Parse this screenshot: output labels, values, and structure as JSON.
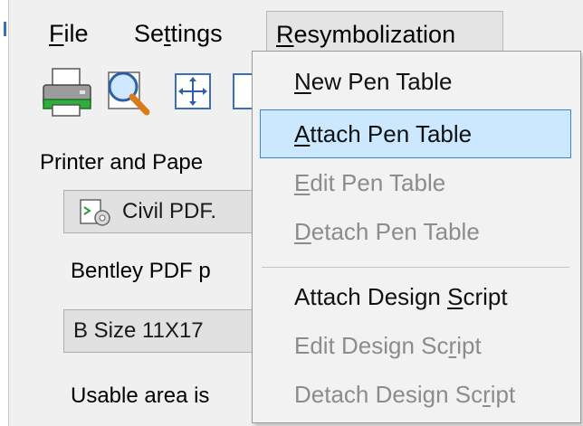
{
  "menubar": {
    "file": {
      "pre": "",
      "u": "F",
      "post": "ile"
    },
    "settings": {
      "pre": "Se",
      "u": "t",
      "post": "tings"
    },
    "resymbolization": {
      "pre": "",
      "u": "R",
      "post": "esymbolization"
    }
  },
  "toolbar": {
    "icons": [
      "printer-icon",
      "print-preview-icon",
      "fit-view-icon",
      "next-icon"
    ]
  },
  "background": {
    "printer_paper_label": "Printer and Pape",
    "driver_value": "Civil PDF.",
    "driver_desc": "Bentley PDF p",
    "paper_size_value": "B Size 11X17",
    "usable_area_label": "Usable area is"
  },
  "resym_menu": {
    "items": [
      {
        "pre": "",
        "u": "N",
        "post": "ew Pen Table",
        "enabled": true,
        "highlighted": false
      },
      {
        "pre": "",
        "u": "A",
        "post": "ttach Pen Table",
        "enabled": true,
        "highlighted": true
      },
      {
        "pre": "",
        "u": "E",
        "post": "dit Pen Table",
        "enabled": false,
        "highlighted": false
      },
      {
        "pre": "",
        "u": "D",
        "post": "etach Pen Table",
        "enabled": false,
        "highlighted": false
      },
      {
        "pre": "Attach Design ",
        "u": "S",
        "post": "cript",
        "enabled": true,
        "highlighted": false
      },
      {
        "pre": "Edit Design Sc",
        "u": "r",
        "post": "ipt",
        "enabled": false,
        "highlighted": false
      },
      {
        "pre": "Detach Design Sc",
        "u": "r",
        "post": "ipt",
        "enabled": false,
        "highlighted": false
      }
    ]
  },
  "colors": {
    "highlight_bg": "#cce8ff",
    "highlight_border": "#3d86d6",
    "disabled_text": "#8c8c8c",
    "menu_bg": "#f2f2f2"
  }
}
